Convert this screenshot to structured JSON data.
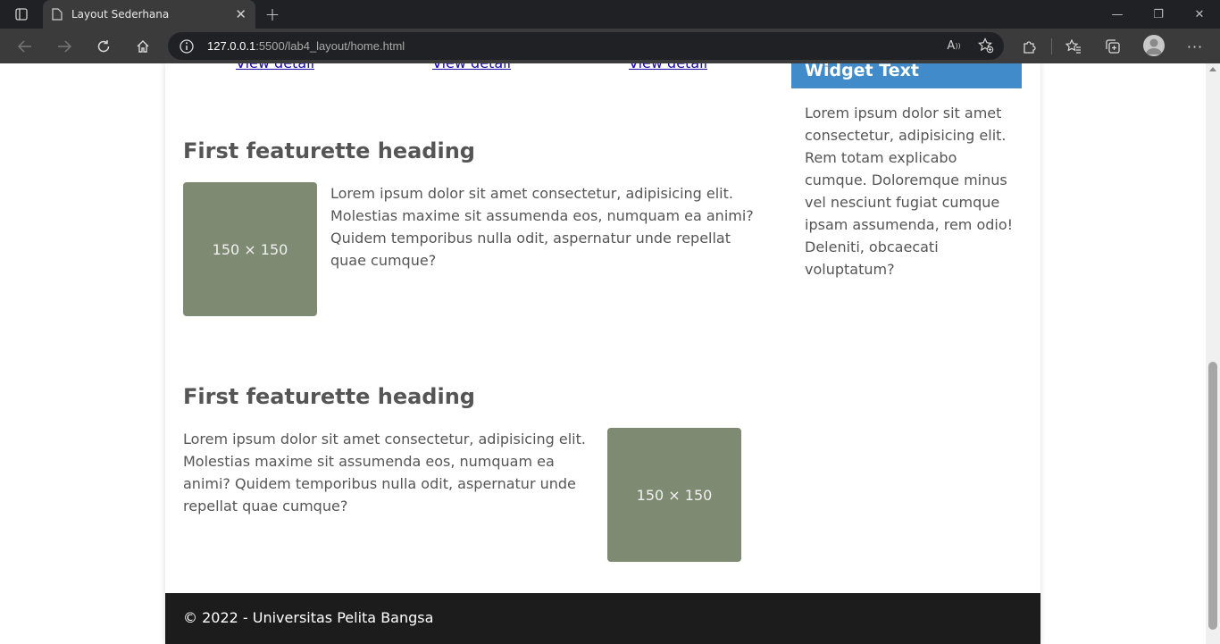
{
  "browser": {
    "tab_title": "Layout Sederhana",
    "url_host": "127.0.0.1",
    "url_rest": ":5500/lab4_layout/home.html"
  },
  "page": {
    "links": [
      "View detail",
      "View detail",
      "View detail"
    ],
    "featurettes": [
      {
        "heading": "First featurette heading",
        "image_label": "150 × 150",
        "text": "Lorem ipsum dolor sit amet consectetur, adipisicing elit. Molestias maxime sit assumenda eos, numquam ea animi? Quidem temporibus nulla odit, aspernatur unde repellat quae cumque?"
      },
      {
        "heading": "First featurette heading",
        "image_label": "150 × 150",
        "text": "Lorem ipsum dolor sit amet consectetur, adipisicing elit. Molestias maxime sit assumenda eos, numquam ea animi? Quidem temporibus nulla odit, aspernatur unde repellat quae cumque?"
      }
    ],
    "widget": {
      "title": "Widget Text",
      "text": "Lorem ipsum dolor sit amet consectetur, adipisicing elit. Rem totam explicabo cumque. Doloremque minus vel nesciunt fugiat cumque ipsam assumenda, rem odio! Deleniti, obcaecati voluptatum?"
    },
    "footer": "© 2022 - Universitas Pelita Bangsa"
  },
  "colors": {
    "widget_header": "#428bca",
    "placeholder": "#7f8a72",
    "footer": "#1d1c1c",
    "link": "#1a0dab"
  }
}
